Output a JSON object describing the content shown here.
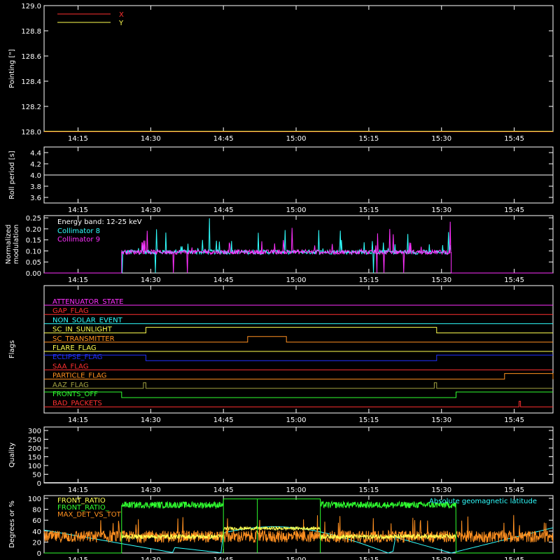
{
  "colors": {
    "background": "#000000",
    "axis": "#ffffff",
    "red": "#ff3030",
    "yellow": "#ffff50",
    "cyan": "#30ffff",
    "magenta": "#ff30ff",
    "orange": "#ff9020",
    "green": "#30ff30",
    "blue": "#2030ff",
    "olive": "#a0a040"
  },
  "time_ticks": [
    "14:15",
    "14:30",
    "14:45",
    "15:00",
    "15:15",
    "15:30",
    "15:45"
  ],
  "chart_data": [
    {
      "id": "pointing",
      "type": "line",
      "ylabel": "Pointing [\"]",
      "ylim": [
        128.0,
        129.0
      ],
      "yticks": [
        "129.0",
        "128.8",
        "128.6",
        "128.4",
        "128.2",
        "128.0"
      ],
      "legend": [
        {
          "name": "X",
          "color": "#ff3030"
        },
        {
          "name": "Y",
          "color": "#ffff50"
        }
      ],
      "series": [
        {
          "name": "X",
          "color": "#ff3030",
          "x": [
            "14:08",
            "15:53"
          ],
          "y": [
            128.0,
            128.0
          ]
        },
        {
          "name": "Y",
          "color": "#ffff50",
          "x": [
            "14:08",
            "15:53"
          ],
          "y": [
            128.0,
            128.0
          ]
        }
      ]
    },
    {
      "id": "roll",
      "type": "line",
      "ylabel": "Roll period [s]",
      "ylim": [
        3.5,
        4.5
      ],
      "yticks": [
        "4.4",
        "4.2",
        "4.0",
        "3.8",
        "3.6"
      ],
      "series": [
        {
          "name": "roll",
          "color": "#ffffff",
          "x": [
            "14:08",
            "15:53"
          ],
          "y": [
            4.0,
            4.0
          ]
        }
      ]
    },
    {
      "id": "modulation",
      "type": "line",
      "ylabel": "Normalized modulation",
      "ylabel_lines": [
        "Normalized",
        "modulation"
      ],
      "ylim": [
        0.0,
        0.26
      ],
      "yticks": [
        "0.25",
        "0.20",
        "0.15",
        "0.10",
        "0.05",
        "0.00"
      ],
      "annotation": "Energy band: 12-25 keV",
      "legend": [
        {
          "name": "Collimator 8",
          "color": "#30ffff"
        },
        {
          "name": "Collimator 9",
          "color": "#ff30ff"
        }
      ],
      "active_range": [
        "14:24",
        "15:32"
      ],
      "baseline": 0.095,
      "series": [
        {
          "name": "Collimator 8",
          "color": "#30ffff"
        },
        {
          "name": "Collimator 9",
          "color": "#ff30ff"
        }
      ]
    },
    {
      "id": "flags",
      "type": "line",
      "ylabel": "Flags",
      "series": [
        {
          "name": "ATTENUATOR_STATE",
          "color": "#ff30ff",
          "steps": []
        },
        {
          "name": "GAP_FLAG",
          "color": "#ff3030",
          "steps": []
        },
        {
          "name": "NON_SOLAR_EVENT",
          "color": "#30ffff",
          "steps": []
        },
        {
          "name": "SC_IN_SUNLIGHT",
          "color": "#ffff50",
          "steps": [
            [
              "14:08",
              0
            ],
            [
              "14:29",
              1
            ],
            [
              "15:29",
              0
            ]
          ]
        },
        {
          "name": "SC_TRANSMITTER",
          "color": "#ff9020",
          "steps": [
            [
              "14:08",
              0
            ],
            [
              "14:50",
              1
            ],
            [
              "14:58",
              0
            ]
          ]
        },
        {
          "name": "FLARE_FLAG",
          "color": "#ffff50",
          "steps": []
        },
        {
          "name": "ECLIPSE_FLAG",
          "color": "#2030ff",
          "steps": [
            [
              "14:08",
              1
            ],
            [
              "14:29",
              0
            ],
            [
              "15:29",
              1
            ]
          ]
        },
        {
          "name": "SAA_FLAG",
          "color": "#ff3030",
          "steps": []
        },
        {
          "name": "PARTICLE_FLAG",
          "color": "#ff9020",
          "steps": [
            [
              "14:08",
              0
            ],
            [
              "15:43",
              1
            ],
            [
              "15:53",
              0
            ]
          ]
        },
        {
          "name": "AAZ_FLAG",
          "color": "#a0a040",
          "steps": [
            [
              "14:08",
              0
            ],
            [
              "14:28.5",
              1
            ],
            [
              "14:29",
              0
            ],
            [
              "15:28.5",
              1
            ],
            [
              "15:29",
              0
            ]
          ]
        },
        {
          "name": "FRONTS_OFF",
          "color": "#30ff30",
          "steps": [
            [
              "14:08",
              1
            ],
            [
              "14:24",
              0
            ],
            [
              "15:33",
              1
            ]
          ]
        },
        {
          "name": "BAD_PACKETS",
          "color": "#ff3030",
          "steps": [
            [
              "14:08",
              0
            ],
            [
              "15:46",
              1
            ],
            [
              "15:46.3",
              0
            ]
          ]
        }
      ]
    },
    {
      "id": "quality",
      "type": "line",
      "ylabel": "Quality",
      "ylim": [
        0,
        320
      ],
      "yticks": [
        "300",
        "250",
        "200",
        "150",
        "100",
        "50",
        "0"
      ],
      "series": [
        {
          "name": "quality",
          "color": "#ffffff",
          "x": [
            "14:08",
            "15:53"
          ],
          "y": [
            0,
            0
          ]
        }
      ]
    },
    {
      "id": "ratios",
      "type": "line",
      "ylabel": "Degrees or %",
      "ylim": [
        0,
        105
      ],
      "yticks": [
        "100",
        "80",
        "60",
        "40",
        "20",
        "0"
      ],
      "legend": [
        {
          "name": "FRONT_RATIO",
          "color": "#ffff50"
        },
        {
          "name": "FRONT_RATIO_",
          "color": "#30ff30"
        },
        {
          "name": "MAX_DET_VS_TOT",
          "color": "#ff9020"
        }
      ],
      "right_legend": {
        "name": "Absolute geomagnetic latitude",
        "color": "#30ffff"
      },
      "series": [
        {
          "name": "FRONT_RATIO",
          "color": "#ffff50"
        },
        {
          "name": "FRONT_RATIO_",
          "color": "#30ff30"
        },
        {
          "name": "MAX_DET_VS_TOT",
          "color": "#ff9020"
        },
        {
          "name": "Absolute geomagnetic latitude",
          "color": "#30ffff"
        }
      ]
    }
  ]
}
